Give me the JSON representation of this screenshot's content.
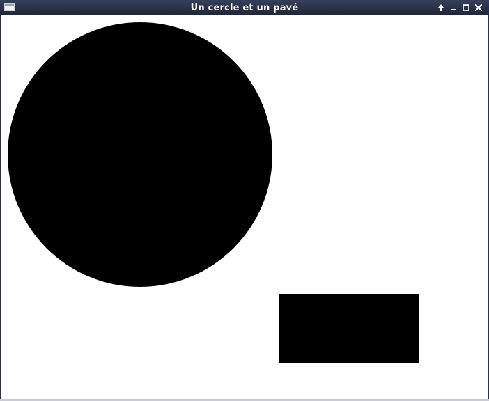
{
  "window": {
    "title": "Un cercle et un pavé"
  },
  "icons": {
    "app": "window-app-icon",
    "up": "arrow-up-icon",
    "minimize": "minimize-icon",
    "maximize": "maximize-icon",
    "close": "close-icon"
  },
  "colors": {
    "titlebar": "#2a3243",
    "canvas": "#ffffff",
    "shapes": "#000000"
  },
  "canvas": {
    "shapes": [
      {
        "type": "circle",
        "name": "cercle"
      },
      {
        "type": "rectangle",
        "name": "pavé"
      }
    ]
  }
}
